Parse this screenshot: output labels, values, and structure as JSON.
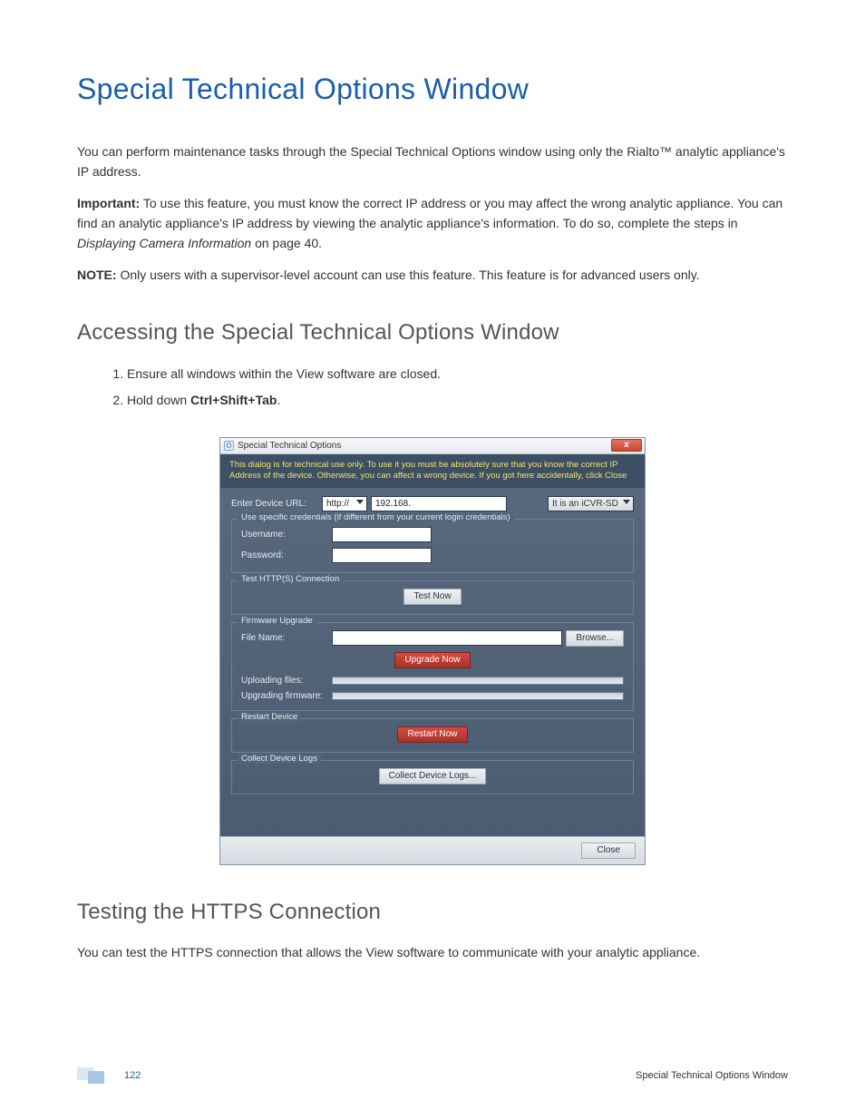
{
  "page_title": "Special Technical Options Window",
  "paragraphs": {
    "intro": "You can perform maintenance tasks through the Special Technical Options window using only the Rialto™ analytic appliance's IP address.",
    "important_label": "Important:",
    "important_text": " To use this feature, you must know the correct IP address or you may affect the wrong analytic appliance. You can find an analytic appliance's IP address by viewing the analytic appliance's information. To do so, complete the steps in ",
    "important_ref": "Displaying Camera Information",
    "important_tail": " on page 40.",
    "note_label": "NOTE:",
    "note_text": " Only users with a supervisor-level account can use this feature. This feature is for advanced users only."
  },
  "h2_accessing": "Accessing the Special Technical Options Window",
  "steps": {
    "s1": "Ensure all windows within the View software are closed.",
    "s2a": "Hold down ",
    "s2b": "Ctrl+Shift+Tab",
    "s2c": "."
  },
  "dialog": {
    "title": "Special Technical Options",
    "close_glyph": "x",
    "icon_glyph": "O",
    "warning": "This dialog is for technical use only. To use it you must be absolutely sure that you know the correct IP Address of the device. Otherwise, you can affect a wrong device. If you got here accidentally, click Close",
    "url_label": "Enter Device URL:",
    "protocol_value": "http://",
    "url_value": "192.168.",
    "type_value": "It is an iCVR-SD",
    "credentials_legend": "Use specific credentials (if different from your current login credentials)",
    "username_label": "Username:",
    "password_label": "Password:",
    "test_legend": "Test HTTP(S) Connection",
    "test_btn": "Test Now",
    "firmware_legend": "Firmware Upgrade",
    "filename_label": "File Name:",
    "browse_btn": "Browse...",
    "upgrade_btn": "Upgrade Now",
    "uploading_label": "Uploading files:",
    "upgrading_label": "Upgrading firmware:",
    "restart_legend": "Restart Device",
    "restart_btn": "Restart Now",
    "collect_legend": "Collect Device Logs",
    "collect_btn": "Collect Device Logs...",
    "close_btn": "Close"
  },
  "h2_testing": "Testing the HTTPS Connection",
  "testing_para": "You can test the HTTPS connection that allows the View software to communicate with your analytic appliance.",
  "footer": {
    "page_number": "122",
    "section": "Special Technical Options Window"
  }
}
